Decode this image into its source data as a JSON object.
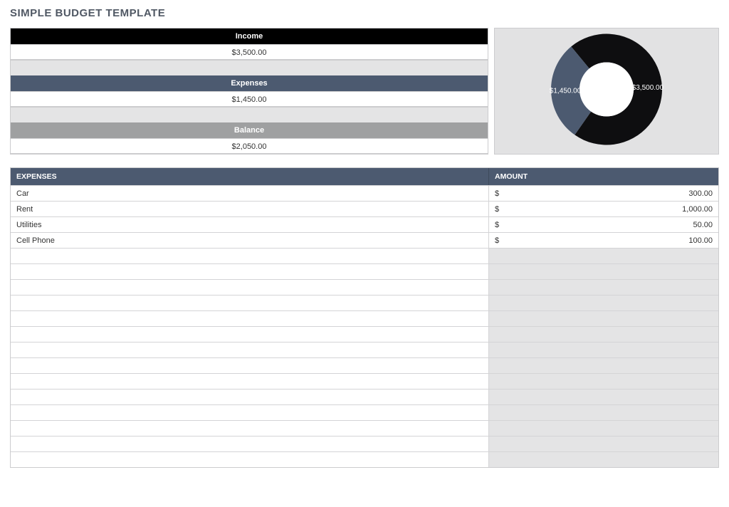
{
  "title": "SIMPLE BUDGET TEMPLATE",
  "summary": {
    "income_label": "Income",
    "income_value": "$3,500.00",
    "expenses_label": "Expenses",
    "expenses_value": "$1,450.00",
    "balance_label": "Balance",
    "balance_value": "$2,050.00"
  },
  "table": {
    "header_expenses": "EXPENSES",
    "header_amount": "AMOUNT",
    "currency": "$",
    "rows": [
      {
        "name": "Car",
        "amount": "300.00"
      },
      {
        "name": "Rent",
        "amount": "1,000.00"
      },
      {
        "name": "Utilities",
        "amount": "50.00"
      },
      {
        "name": "Cell Phone",
        "amount": "100.00"
      }
    ],
    "empty_rows": 14
  },
  "chart_data": {
    "type": "pie",
    "title": "",
    "values": [
      3500,
      1450
    ],
    "categories": [
      "$3,500.00",
      "$1,450.00"
    ],
    "colors": [
      "#0e0e10",
      "#4c5a70"
    ],
    "donut": true,
    "label_color": "#ffffff"
  }
}
